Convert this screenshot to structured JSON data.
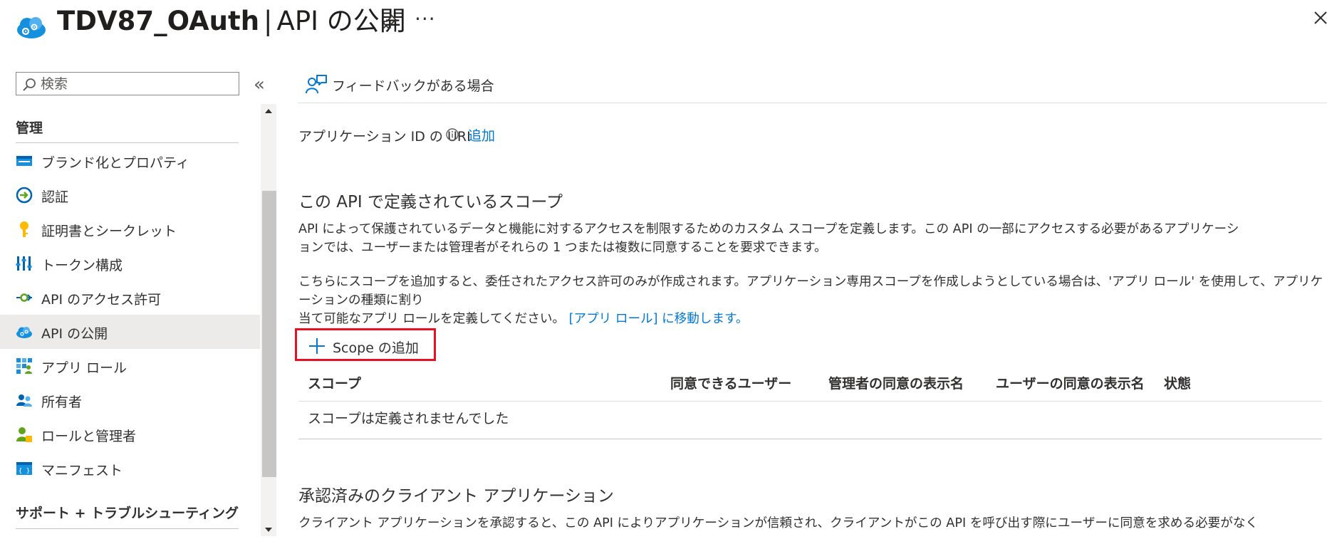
{
  "header": {
    "resource_name": "TDV87_OAuth",
    "separator": "|",
    "page_title": "API の公開",
    "more_label": "···"
  },
  "sidebar": {
    "search_placeholder": "検索",
    "collapse_label": "«",
    "section_manage": "管理",
    "items": [
      {
        "label": "ブランド化とプロパティ",
        "icon": "branding-icon"
      },
      {
        "label": "認証",
        "icon": "authentication-icon"
      },
      {
        "label": "証明書とシークレット",
        "icon": "key-icon"
      },
      {
        "label": "トークン構成",
        "icon": "token-config-icon"
      },
      {
        "label": "API のアクセス許可",
        "icon": "api-permissions-icon"
      },
      {
        "label": "API の公開",
        "icon": "expose-api-icon",
        "selected": true
      },
      {
        "label": "アプリ ロール",
        "icon": "app-roles-icon"
      },
      {
        "label": "所有者",
        "icon": "owners-icon"
      },
      {
        "label": "ロールと管理者",
        "icon": "roles-admins-icon"
      },
      {
        "label": "マニフェスト",
        "icon": "manifest-icon"
      }
    ],
    "section_support": "サポート + トラブルシューティング"
  },
  "main": {
    "feedback_label": "フィードバックがある場合",
    "app_id_uri_label": "アプリケーション ID の URI",
    "app_id_uri_add": "追加",
    "scopes_heading": "この API で定義されているスコープ",
    "scopes_desc_line1": "API によって保護されているデータと機能に対するアクセスを制限するためのカスタム スコープを定義します。この API の一部にアクセスする必要があるアプリケーシ",
    "scopes_desc_line2": "ョンでは、ユーザーまたは管理者がそれらの 1 つまたは複数に同意することを要求できます。",
    "scopes_note_line1": "こちらにスコープを追加すると、委任されたアクセス許可のみが作成されます。アプリケーション専用スコープを作成しようとしている場合は、'アプリ ロール' を使用して、アプリケーションの種類に割り",
    "scopes_note_line2": "当て可能なアプリ ロールを定義してください。",
    "scopes_note_link": "[アプリ ロール] に移動します。",
    "add_scope_label": "Scope の追加",
    "table_headers": {
      "scope": "スコープ",
      "who_can_consent": "同意できるユーザー",
      "admin_consent_name": "管理者の同意の表示名",
      "user_consent_name": "ユーザーの同意の表示名",
      "state": "状態"
    },
    "empty_message": "スコープは定義されませんでした",
    "authorized_heading": "承認済みのクライアント アプリケーション",
    "authorized_desc": "クライアント アプリケーションを承認すると、この API によりアプリケーションが信頼され、クライアントがこの API を呼び出す際にユーザーに同意を求める必要がなく"
  },
  "colors": {
    "accent": "#0078d4",
    "highlight_border": "#e81123",
    "selected_bg": "#edebe9"
  }
}
